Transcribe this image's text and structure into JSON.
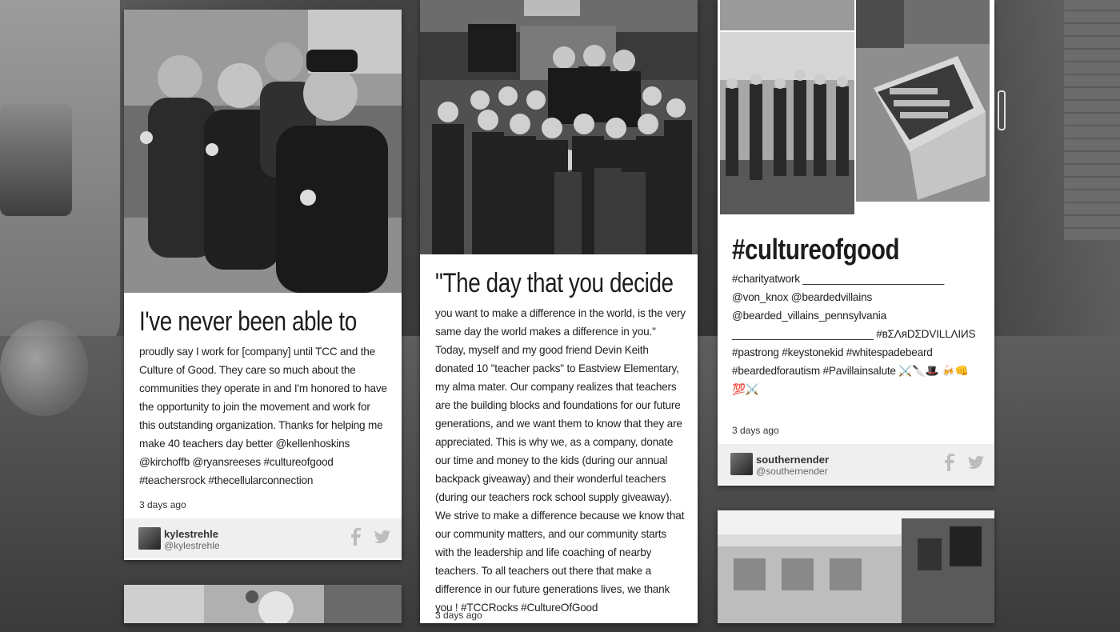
{
  "cards": [
    {
      "headline": "I've never been able to",
      "body": "proudly say I work for [company] until TCC and the Culture of Good. They care so much about the communities they operate in and I'm honored to have the opportunity to join the movement and work for this outstanding organization. Thanks for helping me make 40 teachers day better @kellenhoskins @kirchoffb @ryansreeses #cultureofgood #teachersrock #thecellularconnection",
      "timestamp": "3 days ago",
      "username": "kylestrehle",
      "handle": "@kylestrehle"
    },
    {
      "headline": "\"The day that you decide",
      "body": "you want to make a difference in the world, is the very same day the world makes a difference in you.\" Today, myself and my good friend Devin Keith donated 10 \"teacher packs\" to Eastview Elementary, my alma mater. Our company realizes that teachers are the building blocks and foundations for our future generations, and we want them to know that they are appreciated. This is why we, as a company, donate our time and money to the kids (during our annual backpack giveaway) and their wonderful teachers (during our teachers rock school supply giveaway). We strive to make a difference because we know that our community matters, and our community starts with the leadership and life coaching of nearby teachers. To all teachers out there that make a difference in our future generations lives, we thank you ! #TCCRocks #CultureOfGood",
      "timestamp": "3 days ago"
    },
    {
      "headline": "#cultureofgood",
      "body": "#charityatwork ________________________ @von_knox @beardedvillains @bearded_villains_pennsylvania ________________________ #ʙΣΛяDΣDVILLΛIИS #pastrong #keystonekid #whitespadebeard #beardedforautism #Pavillainsalute ⚔️🔪🎩 🍻👊💯⚔️",
      "timestamp": "3 days ago",
      "username": "southernender",
      "handle": "@southernender"
    }
  ],
  "icons": {
    "facebook": "facebook-icon",
    "twitter": "twitter-icon"
  }
}
